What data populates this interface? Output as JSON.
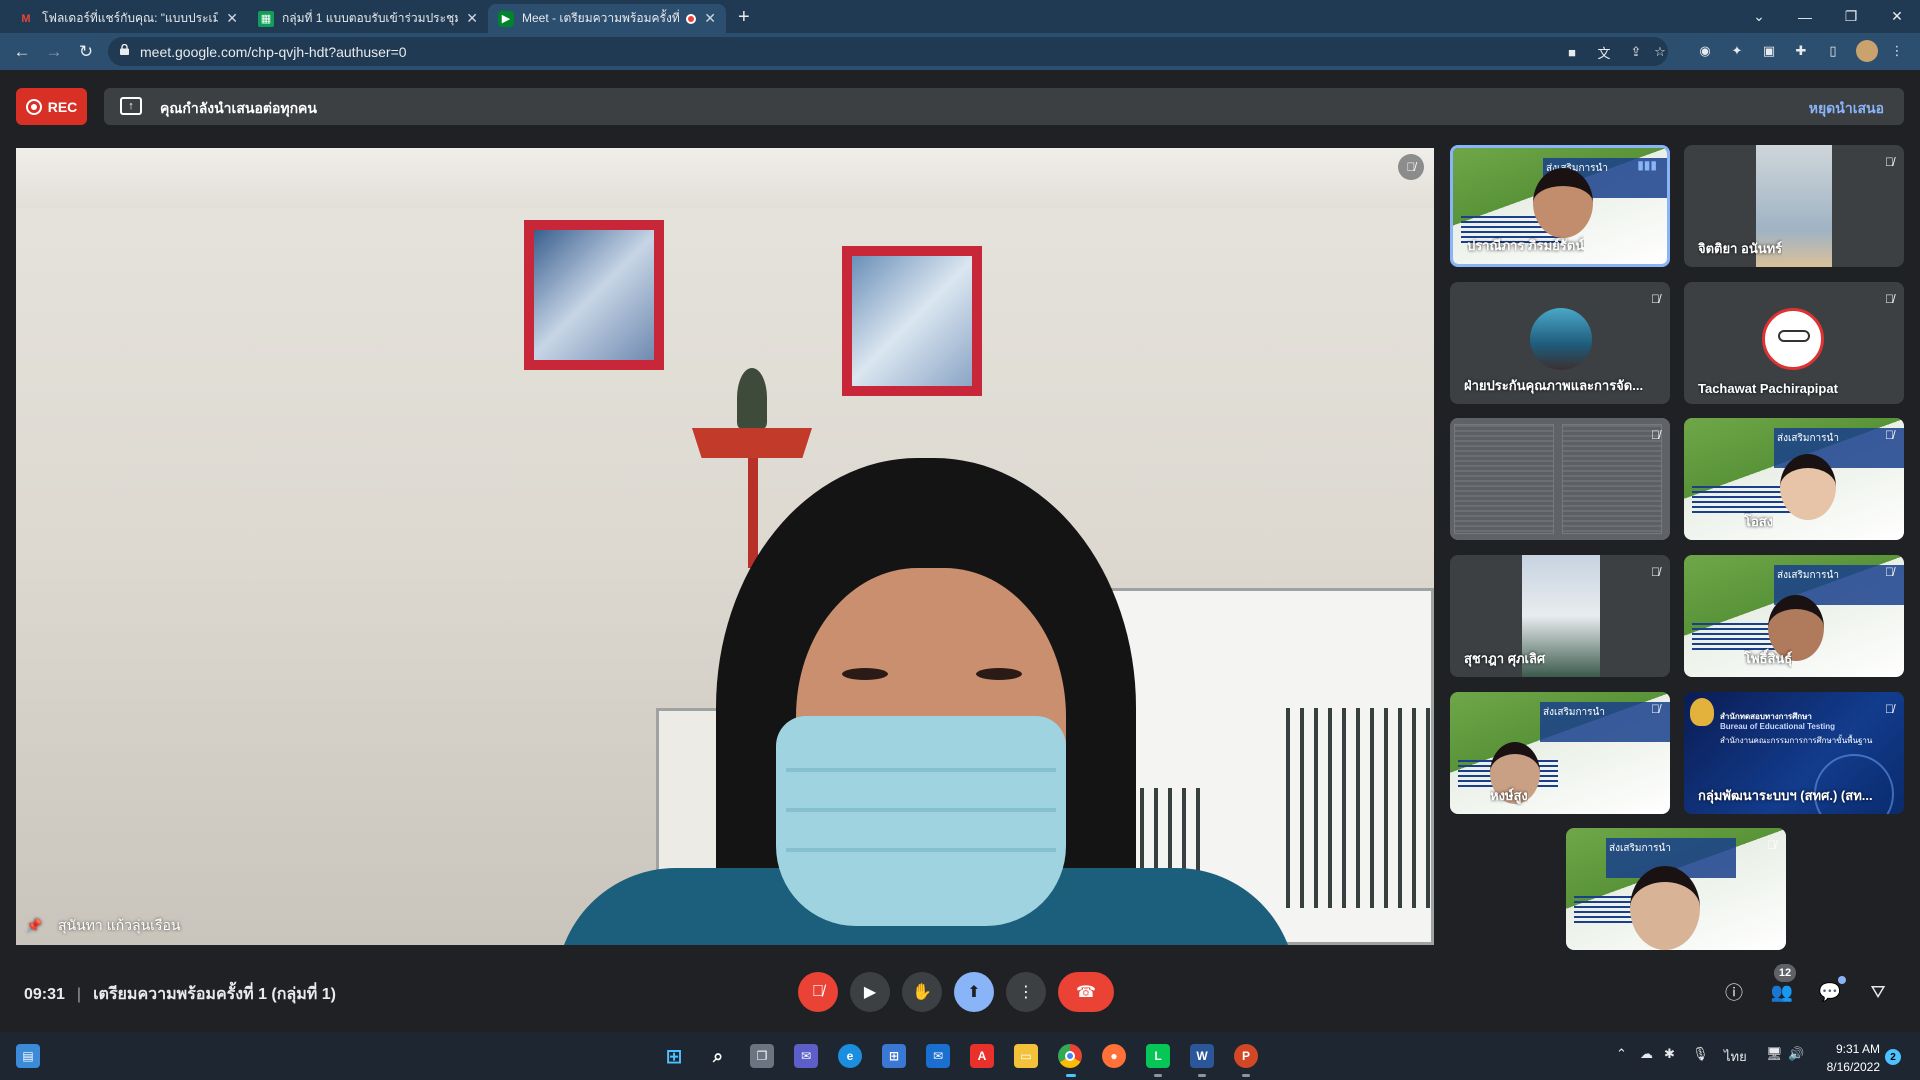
{
  "browser": {
    "tabs": [
      {
        "title": "โฟลเดอร์ที่แชร์กับคุณ: \"แบบประเมิน",
        "favicon": "gmail-icon"
      },
      {
        "title": "กลุ่มที่ 1 แบบตอบรับเข้าร่วมประชุมฯ",
        "favicon": "sheets-icon"
      },
      {
        "title": "Meet - เตรียมความพร้อมครั้งที่ 1",
        "favicon": "meet-icon"
      }
    ],
    "url": "meet.google.com/chp-qvjh-hdt?authuser=0"
  },
  "meet": {
    "rec_label": "REC",
    "presenting_message": "คุณกำลังนำเสนอต่อทุกคน",
    "stop_presenting": "หยุดนำเสนอ",
    "main_speaker": "สุนันทา แก้วลุ่นเรือน",
    "meeting_time": "09:31",
    "meeting_title": "เตรียมความพร้อมครั้งที่ 1 (กลุ่มที่ 1)",
    "participant_count": "12",
    "tiles": [
      {
        "name": "ปราณีภาร ภิรมย์รัตน์",
        "kind": "slide-face"
      },
      {
        "name": "จิตติยา อนันทร์",
        "kind": "photo"
      },
      {
        "name": "ฝ่ายประกันคุณภาพและการจัด...",
        "kind": "avatar"
      },
      {
        "name": "Tachawat Pachirapipat",
        "kind": "avatar"
      },
      {
        "name": "",
        "kind": "document"
      },
      {
        "name": "โอสง",
        "kind": "slide-face"
      },
      {
        "name": "สุชาฎา ศุภเลิศ",
        "kind": "photo"
      },
      {
        "name": "โพธิ์สินธุ์",
        "kind": "slide-face"
      },
      {
        "name": "หงษ์สูง",
        "kind": "slide-face"
      },
      {
        "name": "กลุ่มพัฒนาระบบฯ (สทศ.) (สท...",
        "kind": "bet"
      },
      {
        "name": "",
        "kind": "slide-face"
      }
    ],
    "bet_lines": [
      "สำนักทดสอบทางการศึกษา",
      "Bureau of Educational Testing",
      "สำนักงานคณะกรรมการการศึกษาขั้นพื้นฐาน"
    ],
    "slide_header": "ส่งเสริมการนำ"
  },
  "taskbar": {
    "clock_time": "9:31 AM",
    "clock_date": "8/16/2022",
    "language": "ไทย",
    "notifications": "2"
  },
  "colors": {
    "rec_red": "#d93025",
    "active_tile": "#8ab4f8",
    "hangup": "#ea4335"
  }
}
